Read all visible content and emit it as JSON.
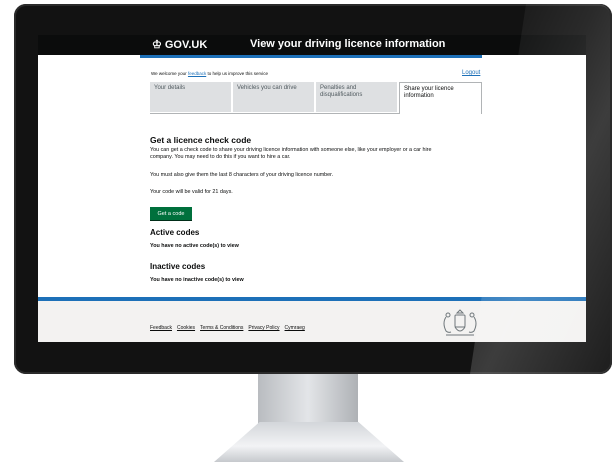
{
  "header": {
    "logo_text": "GOV.UK",
    "service_title": "View your driving licence information",
    "crown_icon": "crown-icon"
  },
  "banner": {
    "prefix": "We welcome your",
    "feedback_link": "feedback",
    "suffix": "to help us improve this service",
    "logout_label": "Logout"
  },
  "tabs": [
    {
      "line1": "Your details",
      "line2": ""
    },
    {
      "line1": "Vehicles you can drive",
      "line2": ""
    },
    {
      "line1": "Penalties and",
      "line2": "disqualifications"
    },
    {
      "line1": "Share your licence",
      "line2": "information"
    }
  ],
  "main": {
    "heading": "Get a licence check code",
    "para1_line1": "You can get a check code to share your driving licence information with someone else, like your employer or a car hire",
    "para1_line2": "company. You may need to do this if you want to hire a car.",
    "para2": "You must also give them the last 8 characters of your driving licence number.",
    "para3": "Your code will be valid for 21 days.",
    "button_label": "Get a code",
    "active_heading": "Active codes",
    "active_empty": "You have no active code(s) to view",
    "inactive_heading": "Inactive codes",
    "inactive_empty": "You have no inactive code(s) to view"
  },
  "footer": {
    "links": [
      "Feedback",
      "Cookies",
      "Terms & Conditions",
      "Privacy Policy",
      "Cymraeg"
    ],
    "crest_icon": "royal-coat-of-arms-icon"
  },
  "colors": {
    "header_bg": "#0b0c0c",
    "link_blue": "#1d70b8",
    "button_green": "#00703c",
    "footer_bg": "#f3f2f1"
  }
}
